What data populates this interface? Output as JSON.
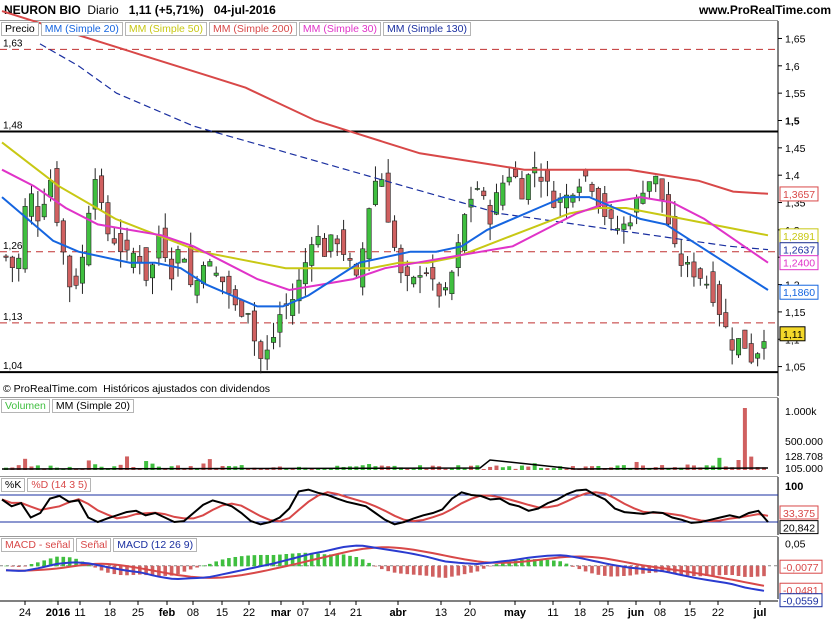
{
  "header": {
    "name": "NEURON BIO",
    "period": "Diario",
    "last": "1,11 (+5,71%)",
    "date": "04-jul-2016",
    "site": "www.ProRealTime.com"
  },
  "colors": {
    "ma20": "#1565e0",
    "ma50": "#c8c814",
    "ma200": "#d84848",
    "ma30": "#e033c8",
    "ma130": "#1a2fa0",
    "up": "#3fbf3f",
    "down": "#d06060",
    "last": "#f3d82a"
  },
  "chart_data": [
    {
      "type": "candlestick",
      "title": "Precio",
      "legend": [
        "Precio",
        "MM (Simple 20)",
        "MM (Simple 50)",
        "MM (Simple 200)",
        "MM (Simple 30)",
        "MM (Simple 130)"
      ],
      "ylim": [
        1.02,
        1.66
      ],
      "y_ticks": [
        "1,65",
        "1,6",
        "1,55",
        "1,5",
        "1,45",
        "1,4",
        "1,35",
        "1,3",
        "1,25",
        "1,2",
        "1,15",
        "1,1",
        "1,05"
      ],
      "support_resistance": [
        {
          "value": 1.63,
          "label": "1,63"
        },
        {
          "value": 1.48,
          "label": "1,48"
        },
        {
          "value": 1.26,
          "label": "1,26"
        },
        {
          "value": 1.13,
          "label": "1,13"
        },
        {
          "value": 1.04,
          "label": "1,04"
        }
      ],
      "last_values": [
        {
          "label": "1,3657",
          "series": "MM (Simple 200)"
        },
        {
          "label": "1,2891",
          "series": "MM (Simple 50)"
        },
        {
          "label": "1,2637",
          "series": "MM (Simple 130)"
        },
        {
          "label": "1,2400",
          "series": "MM (Simple 30)"
        },
        {
          "label": "1,1860",
          "series": "MM (Simple 20)"
        },
        {
          "label": "1,11",
          "series": "Precio"
        }
      ],
      "close_path": [
        1.25,
        1.22,
        1.38,
        1.32,
        1.4,
        1.28,
        1.18,
        1.25,
        1.42,
        1.3,
        1.28,
        1.25,
        1.26,
        1.2,
        1.3,
        1.22,
        1.28,
        1.18,
        1.25,
        1.22,
        1.2,
        1.15,
        1.16,
        1.06,
        1.08,
        1.15,
        1.17,
        1.22,
        1.3,
        1.26,
        1.29,
        1.25,
        1.2,
        1.34,
        1.42,
        1.3,
        1.21,
        1.2,
        1.24,
        1.19,
        1.18,
        1.25,
        1.35,
        1.38,
        1.32,
        1.38,
        1.41,
        1.37,
        1.42,
        1.39,
        1.35,
        1.36,
        1.39,
        1.4,
        1.35,
        1.31,
        1.3,
        1.33,
        1.38,
        1.4,
        1.34,
        1.25,
        1.23,
        1.22,
        1.2,
        1.15,
        1.09,
        1.1,
        1.06,
        1.11
      ],
      "ma20": [
        1.36,
        1.32,
        1.28,
        1.26,
        1.25,
        1.24,
        1.24,
        1.23,
        1.2,
        1.18,
        1.16,
        1.16,
        1.18,
        1.21,
        1.24,
        1.25,
        1.26,
        1.26,
        1.27,
        1.3,
        1.32,
        1.34,
        1.36,
        1.36,
        1.34,
        1.32,
        1.31,
        1.28,
        1.25,
        1.22,
        1.19
      ],
      "ma50": [
        1.46,
        1.42,
        1.38,
        1.35,
        1.32,
        1.3,
        1.28,
        1.26,
        1.25,
        1.24,
        1.23,
        1.23,
        1.23,
        1.23,
        1.24,
        1.24,
        1.25,
        1.27,
        1.29,
        1.31,
        1.33,
        1.34,
        1.34,
        1.33,
        1.32,
        1.31,
        1.3,
        1.29
      ],
      "ma200": [
        1.7,
        1.68,
        1.66,
        1.64,
        1.62,
        1.6,
        1.58,
        1.56,
        1.53,
        1.5,
        1.48,
        1.46,
        1.44,
        1.43,
        1.42,
        1.41,
        1.41,
        1.41,
        1.41,
        1.4,
        1.39,
        1.37,
        1.366
      ],
      "ma30": [
        1.41,
        1.38,
        1.34,
        1.31,
        1.3,
        1.29,
        1.27,
        1.24,
        1.21,
        1.19,
        1.2,
        1.21,
        1.23,
        1.24,
        1.25,
        1.26,
        1.27,
        1.3,
        1.33,
        1.35,
        1.36,
        1.35,
        1.32,
        1.28,
        1.24
      ],
      "ma130": [
        1.64,
        1.6,
        1.55,
        1.52,
        1.49,
        1.47,
        1.45,
        1.43,
        1.41,
        1.39,
        1.37,
        1.35,
        1.33,
        1.32,
        1.31,
        1.3,
        1.29,
        1.28,
        1.27,
        1.264
      ]
    },
    {
      "type": "bar",
      "title": "Volumen",
      "legend": [
        "Volumen",
        "MM (Simple 20)"
      ],
      "y_ticks": [
        "1.000k",
        "500.000",
        "128.708",
        "105.000"
      ]
    },
    {
      "type": "line",
      "title": "%K %D (14 3 5)",
      "legend": [
        "%K",
        "%D (14 3 5)"
      ],
      "ylim": [
        0,
        120
      ],
      "y_ticks": [
        "100"
      ],
      "last_values": [
        "33,375",
        "20,842"
      ],
      "k": [
        70,
        55,
        62,
        30,
        40,
        72,
        78,
        65,
        68,
        30,
        20,
        28,
        35,
        42,
        45,
        35,
        40,
        30,
        20,
        22,
        40,
        58,
        68,
        62,
        55,
        40,
        22,
        15,
        20,
        30,
        50,
        88,
        92,
        85,
        80,
        72,
        65,
        60,
        55,
        40,
        25,
        15,
        20,
        28,
        35,
        40,
        48,
        72,
        86,
        80,
        78,
        70,
        72,
        60,
        55,
        45,
        50,
        62,
        70,
        82,
        90,
        92,
        80,
        70,
        50,
        42,
        40,
        38,
        42,
        40,
        30,
        25,
        18,
        20,
        25,
        30,
        35,
        30,
        40,
        45,
        20
      ]
    },
    {
      "type": "bar",
      "title": "MACD",
      "legend": [
        "MACD - señal",
        "Señal",
        "MACD (12 26 9)"
      ],
      "ylim": [
        -0.07,
        0.06
      ],
      "y_ticks": [
        "0,05",
        "0"
      ],
      "last_values": [
        "-0,0077",
        "-0,0481",
        "-0,0559"
      ],
      "macd": [
        -0.01,
        -0.012,
        -0.005,
        0.004,
        0.008,
        0.005,
        -0.003,
        -0.01,
        -0.015,
        -0.024,
        -0.03,
        -0.028,
        -0.026,
        -0.018,
        -0.01,
        -0.002,
        0.006,
        0.016,
        0.026,
        0.033,
        0.042,
        0.046,
        0.04,
        0.034,
        0.028,
        0.02,
        0.01,
        0.006,
        0.004,
        0.008,
        0.012,
        0.018,
        0.022,
        0.024,
        0.018,
        0.01,
        0.002,
        -0.004,
        -0.008,
        -0.012,
        -0.02,
        -0.028,
        -0.034,
        -0.04,
        -0.05,
        -0.056
      ]
    },
    {
      "type": "axis",
      "x_ticks": [
        "24",
        "2016",
        "11",
        "18",
        "25",
        "feb",
        "08",
        "15",
        "22",
        "mar",
        "07",
        "14",
        "21",
        "abr",
        "13",
        "20",
        "may",
        "11",
        "18",
        "25",
        "jun",
        "08",
        "15",
        "22",
        "jul"
      ]
    }
  ]
}
